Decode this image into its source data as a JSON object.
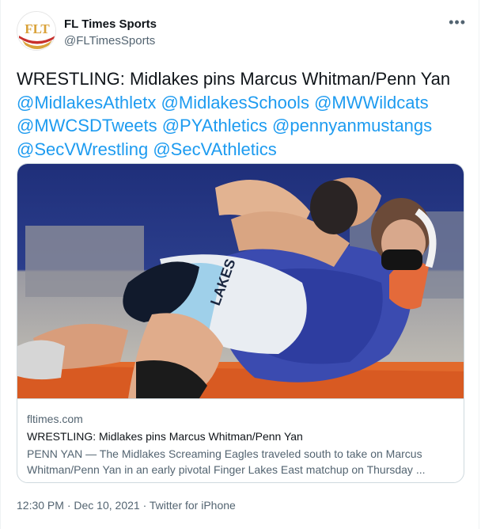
{
  "tweet": {
    "author": {
      "display_name": "FL Times Sports",
      "handle": "@FLTimesSports",
      "avatar_letters": "FLT"
    },
    "more_menu": "•••",
    "text": {
      "body": "WRESTLING: Midlakes pins Marcus Whitman/Penn Yan",
      "mentions": [
        "@MidlakesAthletx",
        "@MidlakesSchools",
        "@MWWildcats",
        "@MWCSDTweets",
        "@PYAthletics",
        "@pennyanmustangs",
        "@SecVWrestling",
        "@SecVAthletics"
      ]
    },
    "card": {
      "domain": "fltimes.com",
      "title": "WRESTLING: Midlakes pins Marcus Whitman/Penn Yan",
      "description": "PENN YAN — The Midlakes Screaming Eagles traveled south to take on Marcus Whitman/Penn Yan in an early pivotal Finger Lakes East matchup on Thursday ..."
    },
    "meta": {
      "time": "12:30 PM",
      "separator": "·",
      "date": "Dec 10, 2021",
      "source": "Twitter for iPhone"
    }
  },
  "colors": {
    "link": "#1d9bf0",
    "text": "#0f1419",
    "secondary": "#536471",
    "border": "#cfd9de",
    "avatar_red": "#c8302c",
    "avatar_gold": "#d9a23a"
  }
}
